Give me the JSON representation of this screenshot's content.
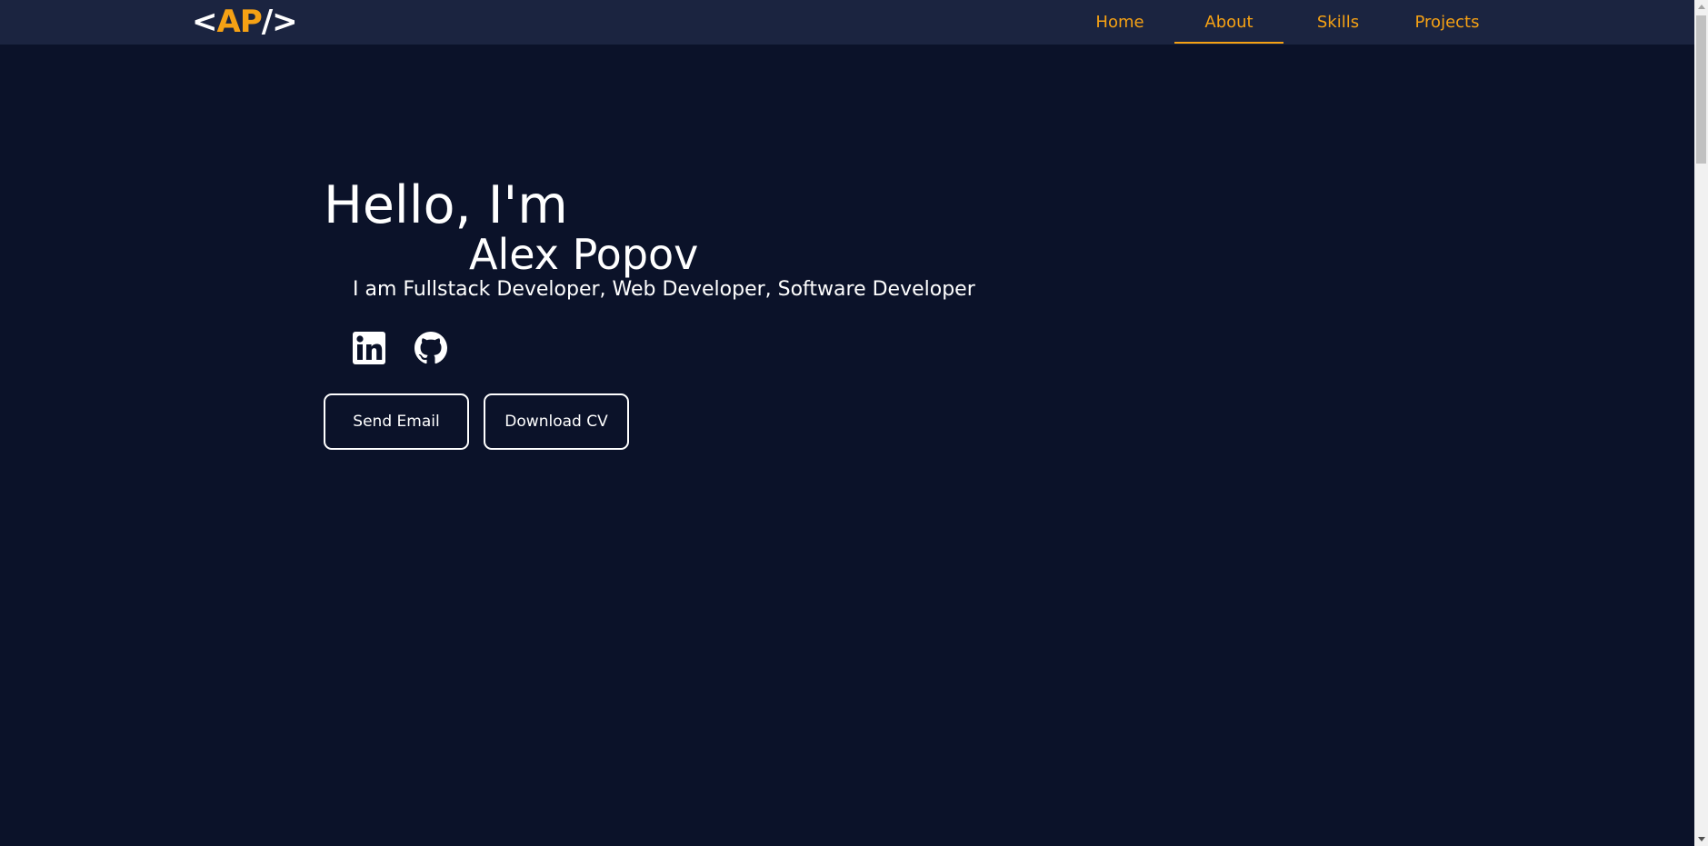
{
  "header": {
    "logo": {
      "open_bracket": "<",
      "initials": "AP",
      "close_bracket": "/>"
    },
    "nav": [
      {
        "label": "Home",
        "active": false
      },
      {
        "label": "About",
        "active": true
      },
      {
        "label": "Skills",
        "active": false
      },
      {
        "label": "Projects",
        "active": false
      }
    ]
  },
  "hero": {
    "greeting": "Hello, I'm",
    "name": "Alex Popov",
    "tagline": "I am Fullstack Developer, Web Developer, Software Developer",
    "social": [
      {
        "icon": "linkedin-icon"
      },
      {
        "icon": "github-icon"
      }
    ],
    "buttons": {
      "send_email": "Send Email",
      "download_cv": "Download CV"
    }
  },
  "colors": {
    "background": "#0b1229",
    "navbar": "#1b2440",
    "accent": "#f5a114",
    "text": "#ffffff"
  }
}
